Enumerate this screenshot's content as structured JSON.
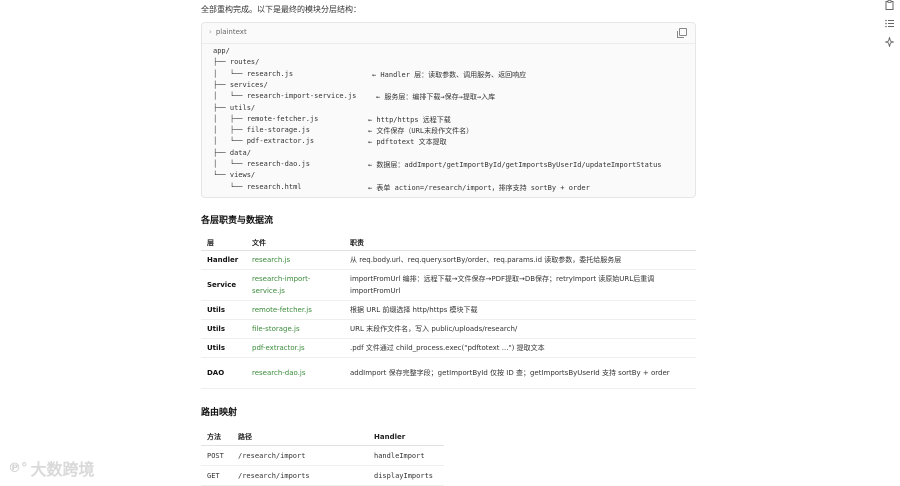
{
  "intro": "全部重构完成。以下是最终的模块分层结构：",
  "code_block": {
    "language": "plaintext",
    "lines": [
      {
        "tree": "app/",
        "note": ""
      },
      {
        "tree": "├── routes/",
        "note": ""
      },
      {
        "tree": "│   └── research.js",
        "note": "← Handler 层：读取参数、调用服务、返回响应"
      },
      {
        "tree": "├── services/",
        "note": ""
      },
      {
        "tree": "│   └── research-import-service.js",
        "note": "← 服务层：编排下载→保存→提取→入库"
      },
      {
        "tree": "├── utils/",
        "note": ""
      },
      {
        "tree": "│   ├── remote-fetcher.js",
        "note": "← http/https 远程下载"
      },
      {
        "tree": "│   ├── file-storage.js",
        "note": "← 文件保存（URL末段作文件名）"
      },
      {
        "tree": "│   └── pdf-extractor.js",
        "note": "← pdftotext 文本提取"
      },
      {
        "tree": "├── data/",
        "note": ""
      },
      {
        "tree": "│   └── research-dao.js",
        "note": "← 数据层：addImport/getImportById/getImportsByUserId/updateImportStatus"
      },
      {
        "tree": "└── views/",
        "note": ""
      },
      {
        "tree": "    └── research.html",
        "note": "← 表单 action=/research/import，排序支持 sortBy + order"
      }
    ]
  },
  "section1_title": "各层职责与数据流",
  "resp_table": {
    "headers": [
      "层",
      "文件",
      "职责"
    ],
    "rows": [
      {
        "layer": "Handler",
        "file": "research.js",
        "desc": "从 req.body.url、req.query.sortBy/order、req.params.id 读取参数，委托给服务层"
      },
      {
        "layer": "Service",
        "file": "research-import-service.js",
        "desc": "importFromUrl 编排：远程下载→文件保存→PDF提取→DB保存；retryImport 读原始URL后重调 importFromUrl"
      },
      {
        "layer": "Utils",
        "file": "remote-fetcher.js",
        "desc": "根据 URL 前缀选择 http/https 模块下载"
      },
      {
        "layer": "Utils",
        "file": "file-storage.js",
        "desc": "URL 末段作文件名，写入 public/uploads/research/"
      },
      {
        "layer": "Utils",
        "file": "pdf-extractor.js",
        "desc": ".pdf 文件通过 child_process.exec(\"pdftotext ...\") 提取文本"
      },
      {
        "layer": "DAO",
        "file": "research-dao.js",
        "desc": "addImport 保存完整字段；getImportById 仅按 ID 查；getImportsByUserId 支持 sortBy + order"
      }
    ]
  },
  "section2_title": "路由映射",
  "route_table": {
    "headers": [
      "方法",
      "路径",
      "Handler"
    ],
    "rows": [
      {
        "method": "POST",
        "path": "/research/import",
        "handler": "handleImport"
      },
      {
        "method": "GET",
        "path": "/research/imports",
        "handler": "displayImports"
      }
    ]
  },
  "watermark": "大数跨境",
  "watermark_logo": "℗°"
}
